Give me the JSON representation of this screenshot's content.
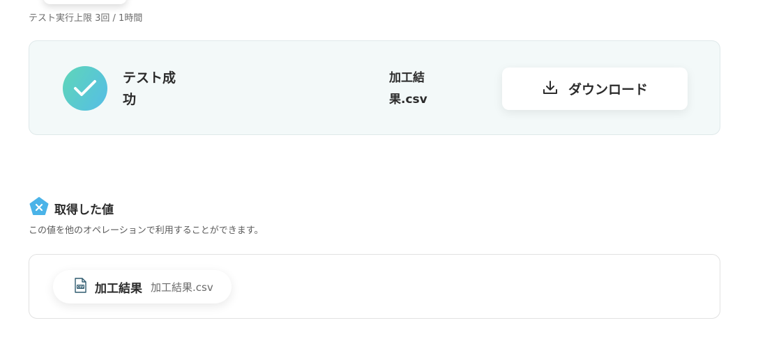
{
  "header": {
    "limit_note": "テスト実行上限 3回 / 1時間"
  },
  "result": {
    "status_label": "テスト成功",
    "file_name": "加工結果.csv",
    "download_label": "ダウンロード",
    "badge_gradient": [
      "#5fd6b8",
      "#55bde6"
    ]
  },
  "values_section": {
    "title": "取得した値",
    "description": "この値を他のオペレーションで利用することができます。",
    "items": [
      {
        "key": "加工結果",
        "value": "加工結果.csv",
        "icon": "csv-file-icon"
      }
    ]
  },
  "colors": {
    "card_background": "#f3f9f9",
    "accent_blue": "#4ab3e8"
  }
}
